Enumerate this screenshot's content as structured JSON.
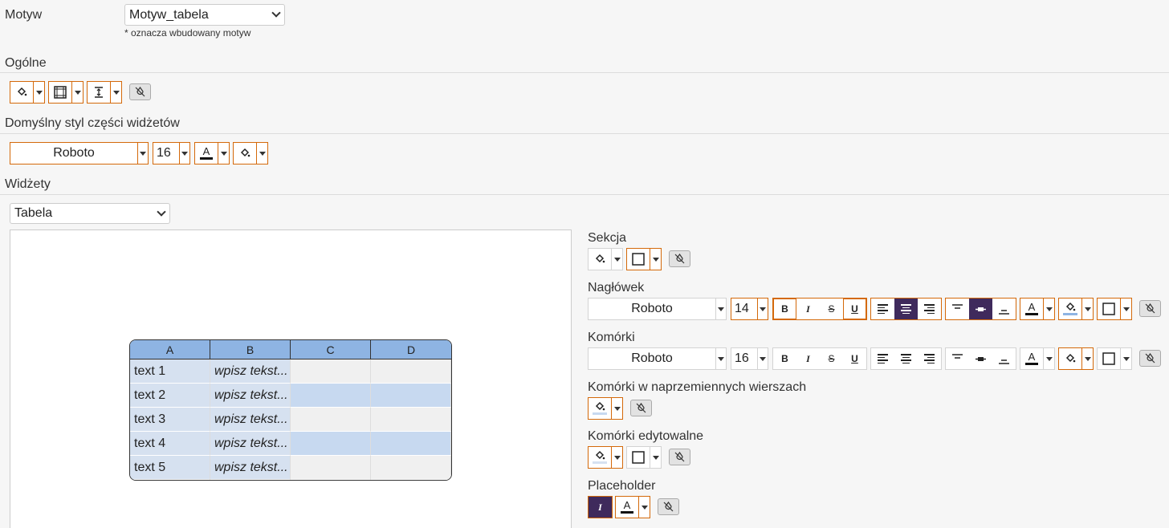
{
  "theme": {
    "label": "Motyw",
    "selected": "Motyw_tabela",
    "hint": "* oznacza wbudowany motyw"
  },
  "general": {
    "title": "Ogólne"
  },
  "default_style": {
    "title": "Domyślny styl części widżetów",
    "font": "Roboto",
    "size": "16"
  },
  "widgets": {
    "title": "Widżety",
    "selected": "Tabela"
  },
  "table": {
    "headers": [
      "A",
      "B",
      "C",
      "D"
    ],
    "rows": [
      [
        "text 1",
        "wpisz tekst...",
        "",
        ""
      ],
      [
        "text 2",
        "wpisz tekst...",
        "",
        ""
      ],
      [
        "text 3",
        "wpisz tekst...",
        "",
        ""
      ],
      [
        "text 4",
        "wpisz tekst...",
        "",
        ""
      ],
      [
        "text 5",
        "wpisz tekst...",
        "",
        ""
      ]
    ]
  },
  "sections": {
    "section": {
      "title": "Sekcja"
    },
    "header": {
      "title": "Nagłówek",
      "font": "Roboto",
      "size": "14"
    },
    "cells": {
      "title": "Komórki",
      "font": "Roboto",
      "size": "16"
    },
    "alt_rows": {
      "title": "Komórki w naprzemiennych wierszach"
    },
    "editable": {
      "title": "Komórki edytowalne"
    },
    "placeholder": {
      "title": "Placeholder"
    }
  },
  "icons": {
    "bold": "B",
    "italic": "I",
    "strike": "S",
    "underline": "U",
    "text_color": "A",
    "placeholder_italic": "I"
  },
  "colors": {
    "accent": "#d4690a",
    "active": "#3f2a5c",
    "header_fill": "#8eb4e3"
  }
}
